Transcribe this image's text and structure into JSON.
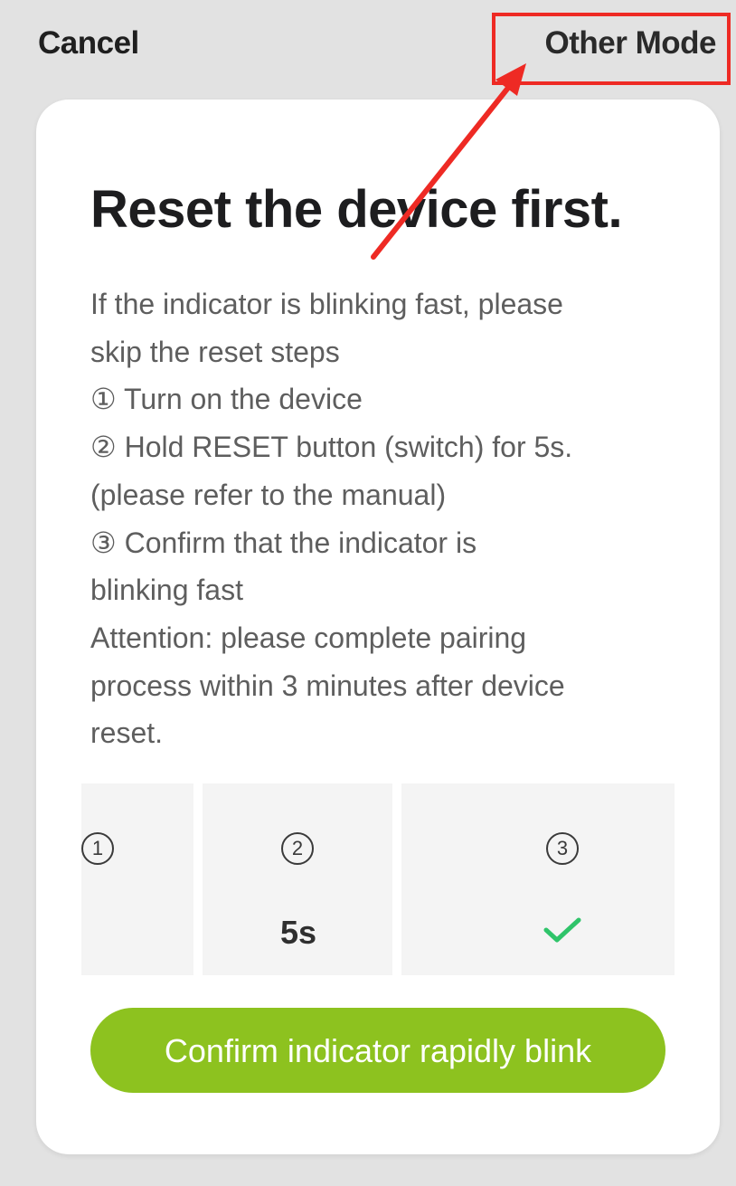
{
  "header": {
    "cancel_label": "Cancel",
    "other_mode_label": "Other Mode"
  },
  "card": {
    "title": "Reset the device first.",
    "instructions": [
      "If the indicator is blinking fast, please",
      "skip the reset steps",
      "①  Turn on the device",
      "②  Hold RESET button (switch) for 5s.",
      "(please refer to the manual)",
      "③  Confirm that the indicator is",
      "blinking fast",
      "Attention: please complete pairing",
      "process within 3 minutes after device",
      "reset."
    ],
    "steps": [
      {
        "number": "1",
        "label": ""
      },
      {
        "number": "2",
        "label": "5s"
      },
      {
        "number": "3",
        "label": "",
        "icon": "check-icon"
      }
    ],
    "confirm_button_label": "Confirm indicator rapidly blink"
  },
  "colors": {
    "background": "#e2e2e2",
    "card": "#ffffff",
    "accent_green": "#8dc21f",
    "check_green": "#2fc46a",
    "annotation_red": "#ee2a24"
  }
}
